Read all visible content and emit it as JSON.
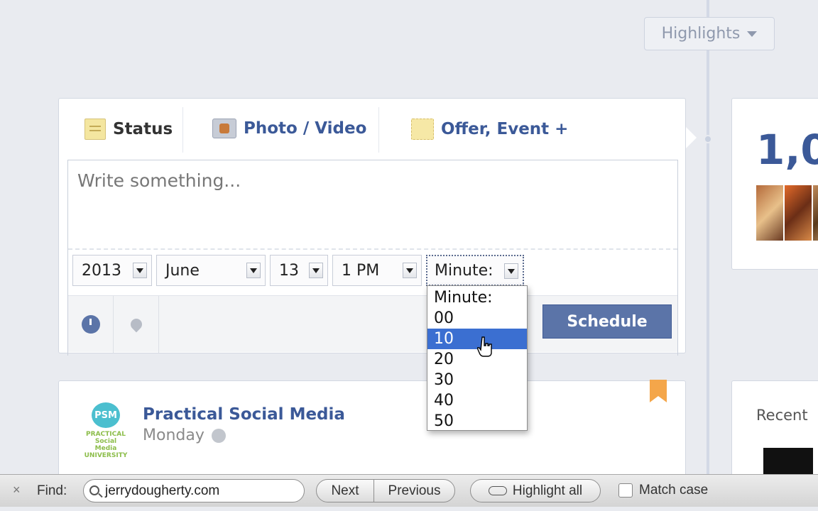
{
  "highlights": {
    "label": "Highlights"
  },
  "composer": {
    "tabs": [
      {
        "label": "Status",
        "icon": "status-icon"
      },
      {
        "label": "Photo / Video",
        "icon": "photo-icon"
      },
      {
        "label": "Offer, Event +",
        "icon": "offer-icon"
      }
    ],
    "placeholder": "Write something...",
    "schedule": {
      "year": "2013",
      "month": "June",
      "day": "13",
      "hour": "1 PM",
      "minute": "Minute:"
    },
    "minute_options": [
      "Minute:",
      "00",
      "10",
      "20",
      "30",
      "40",
      "50"
    ],
    "minute_highlighted": "10",
    "schedule_button": "Schedule"
  },
  "post": {
    "page_name": "Practical Social Media",
    "date": "Monday",
    "logo_text": "PSM",
    "logo_sub": "PRACTICAL Social Media UNIVERSITY"
  },
  "right": {
    "count_partial": "1,0",
    "recent_label": "Recent"
  },
  "findbar": {
    "close": "×",
    "find_label": "Find:",
    "query": "jerrydougherty.com",
    "next": "Next",
    "previous": "Previous",
    "highlight_all": "Highlight all",
    "match_case": "Match case"
  },
  "colors": {
    "facebook_blue": "#3b5998",
    "button_blue": "#5b74a8",
    "selection_blue": "#3b6fd1",
    "bookmark_orange": "#f4a64a"
  }
}
